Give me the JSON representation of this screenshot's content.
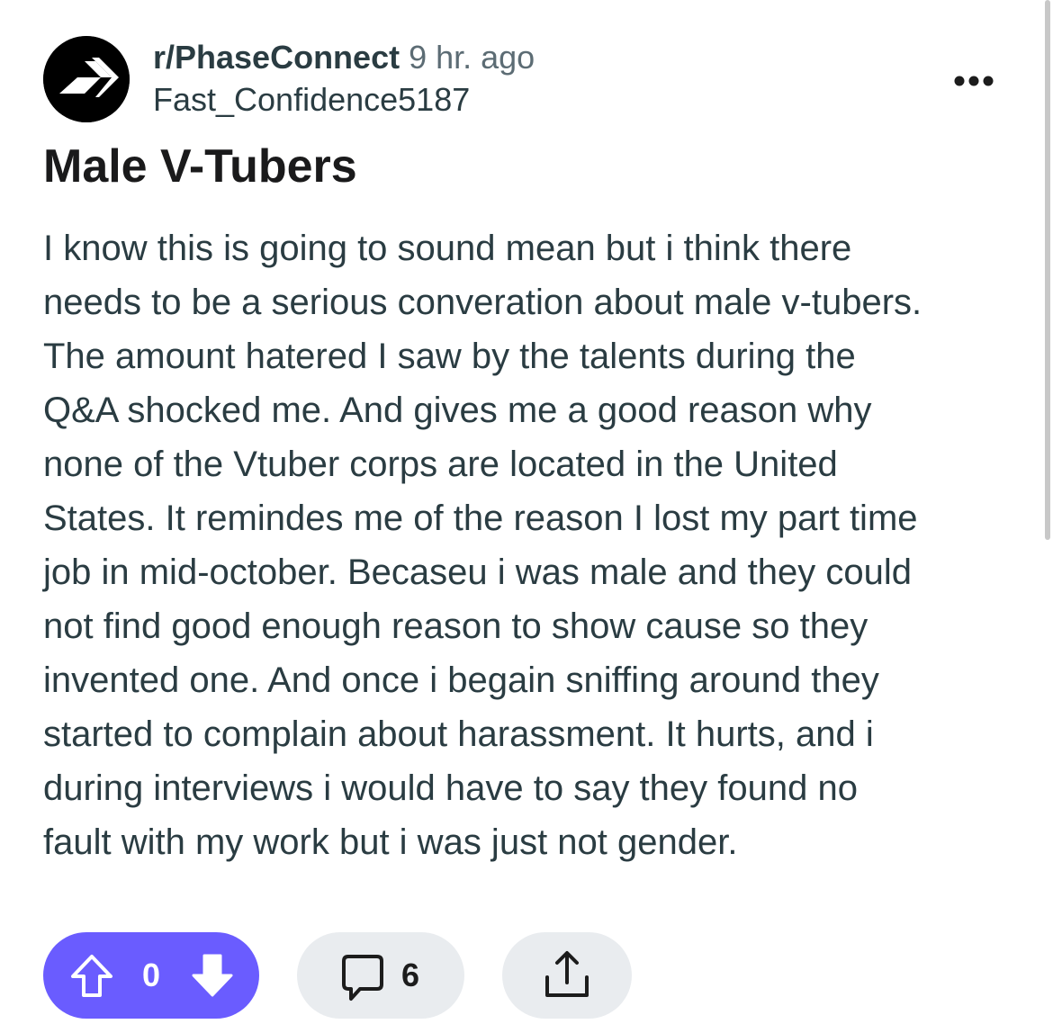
{
  "post": {
    "subreddit": "r/PhaseConnect",
    "time_ago": "9 hr. ago",
    "author": "Fast_Confidence5187",
    "title": "Male V-Tubers",
    "body_lines": [
      "I know this is going to sound mean but i think there",
      "needs to be a serious converation about male v-tubers.",
      "The amount hatered I saw by the talents during the",
      "Q&A shocked me. And gives me a good reason why",
      "none of the Vtuber corps are located in the United",
      "States. It remindes me of the reason I lost my part time",
      "job in mid-october. Becaseu i was male and they could",
      "not find good enough reason to show cause so they",
      "invented one. And once i begain sniffing around they",
      "started to complain about harassment. It hurts, and i",
      "during interviews i would have to say they found no",
      "fault with my work but i was just not gender."
    ]
  },
  "actions": {
    "score": "0",
    "comment_count": "6"
  },
  "icons": {
    "avatar": "phaseconnect-logo-icon",
    "more": "more-options-icon",
    "upvote": "upvote-arrow-icon",
    "downvote": "downvote-arrow-icon",
    "comment": "comment-bubble-icon",
    "share": "share-icon"
  },
  "colors": {
    "vote_pill": "#6a5cff",
    "pill_gray": "#e9ecef",
    "text_primary": "#1a1a1b",
    "text_body": "#2a3c42",
    "text_muted": "#5c6c74"
  }
}
